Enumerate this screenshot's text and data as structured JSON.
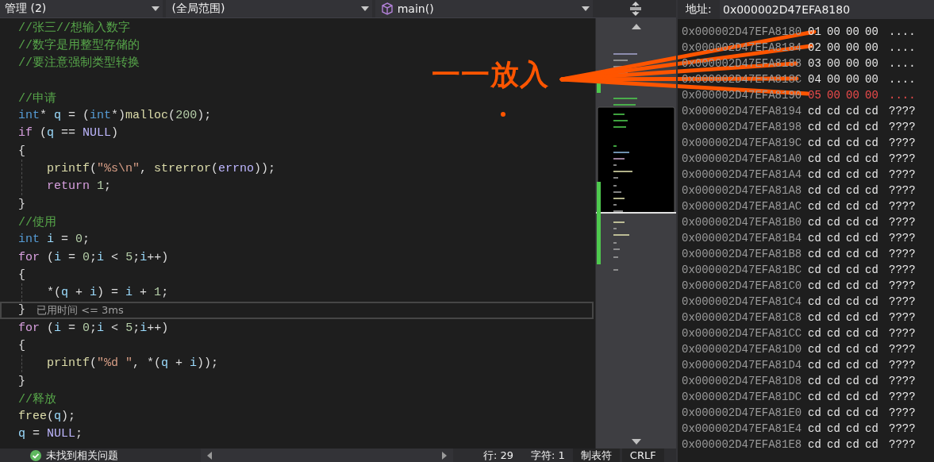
{
  "toolbar": {
    "dropdowns": [
      {
        "text": "管理 (2)",
        "kind": "plain"
      },
      {
        "text": "(全局范围)",
        "kind": "plain"
      },
      {
        "text": "main()",
        "kind": "function"
      }
    ]
  },
  "editor": {
    "lines": [
      {
        "kind": "code",
        "current": false,
        "tokens": [
          {
            "kind": "comment",
            "text": "//张三//想输入数字"
          }
        ]
      },
      {
        "kind": "code",
        "current": false,
        "tokens": [
          {
            "kind": "comment",
            "text": "//数字是用整型存储的"
          }
        ]
      },
      {
        "kind": "code",
        "current": false,
        "tokens": [
          {
            "kind": "comment",
            "text": "//要注意强制类型转换"
          }
        ]
      },
      {
        "kind": "blank",
        "current": false
      },
      {
        "kind": "code",
        "current": false,
        "tokens": [
          {
            "kind": "comment",
            "text": "//申请"
          }
        ]
      },
      {
        "kind": "code",
        "current": false,
        "tokens": [
          {
            "kind": "type",
            "text": "int"
          },
          {
            "kind": "punct",
            "text": "* "
          },
          {
            "kind": "var",
            "text": "q"
          },
          {
            "kind": "punct",
            "text": " = ("
          },
          {
            "kind": "type",
            "text": "int"
          },
          {
            "kind": "punct",
            "text": "*)"
          },
          {
            "kind": "func",
            "text": "malloc"
          },
          {
            "kind": "punct",
            "text": "("
          },
          {
            "kind": "number",
            "text": "200"
          },
          {
            "kind": "punct",
            "text": ");"
          }
        ]
      },
      {
        "kind": "code",
        "current": false,
        "tokens": [
          {
            "kind": "control",
            "text": "if"
          },
          {
            "kind": "punct",
            "text": " ("
          },
          {
            "kind": "var",
            "text": "q"
          },
          {
            "kind": "punct",
            "text": " == "
          },
          {
            "kind": "macro",
            "text": "NULL"
          },
          {
            "kind": "punct",
            "text": ")"
          }
        ]
      },
      {
        "kind": "code",
        "current": false,
        "tokens": [
          {
            "kind": "punct",
            "text": "{"
          }
        ],
        "children": [
          {
            "kind": "code",
            "current": false,
            "tokens": [
              {
                "kind": "func",
                "text": "printf"
              },
              {
                "kind": "punct",
                "text": "("
              },
              {
                "kind": "string",
                "text": "\"%s\\n\""
              },
              {
                "kind": "punct",
                "text": ", "
              },
              {
                "kind": "func",
                "text": "strerror"
              },
              {
                "kind": "punct",
                "text": "("
              },
              {
                "kind": "macro",
                "text": "errno"
              },
              {
                "kind": "punct",
                "text": "));"
              }
            ]
          },
          {
            "kind": "code",
            "current": false,
            "tokens": [
              {
                "kind": "control",
                "text": "return "
              },
              {
                "kind": "number",
                "text": "1"
              },
              {
                "kind": "punct",
                "text": ";"
              }
            ]
          }
        ]
      },
      {
        "kind": "code",
        "current": false,
        "tokens": [
          {
            "kind": "punct",
            "text": "}"
          }
        ]
      },
      {
        "kind": "code",
        "current": false,
        "tokens": [
          {
            "kind": "comment",
            "text": "//使用"
          }
        ]
      },
      {
        "kind": "code",
        "current": false,
        "tokens": [
          {
            "kind": "type",
            "text": "int "
          },
          {
            "kind": "var",
            "text": "i"
          },
          {
            "kind": "punct",
            "text": " = "
          },
          {
            "kind": "number",
            "text": "0"
          },
          {
            "kind": "punct",
            "text": ";"
          }
        ]
      },
      {
        "kind": "code",
        "current": false,
        "tokens": [
          {
            "kind": "control",
            "text": "for"
          },
          {
            "kind": "punct",
            "text": " ("
          },
          {
            "kind": "var",
            "text": "i"
          },
          {
            "kind": "punct",
            "text": " = "
          },
          {
            "kind": "number",
            "text": "0"
          },
          {
            "kind": "punct",
            "text": ";"
          },
          {
            "kind": "var",
            "text": "i"
          },
          {
            "kind": "punct",
            "text": " < "
          },
          {
            "kind": "number",
            "text": "5"
          },
          {
            "kind": "punct",
            "text": ";"
          },
          {
            "kind": "var",
            "text": "i"
          },
          {
            "kind": "punct",
            "text": "++)"
          }
        ]
      },
      {
        "kind": "code",
        "current": false,
        "tokens": [
          {
            "kind": "punct",
            "text": "{"
          }
        ],
        "children": [
          {
            "kind": "code",
            "current": false,
            "tokens": [
              {
                "kind": "punct",
                "text": "*("
              },
              {
                "kind": "var",
                "text": "q"
              },
              {
                "kind": "punct",
                "text": " + "
              },
              {
                "kind": "var",
                "text": "i"
              },
              {
                "kind": "punct",
                "text": ") = "
              },
              {
                "kind": "var",
                "text": "i"
              },
              {
                "kind": "punct",
                "text": " + "
              },
              {
                "kind": "number",
                "text": "1"
              },
              {
                "kind": "punct",
                "text": ";"
              }
            ]
          }
        ]
      },
      {
        "kind": "code",
        "current": true,
        "tokens": [
          {
            "kind": "punct",
            "text": "}"
          }
        ],
        "hint": "已用时间 <= 3ms"
      },
      {
        "kind": "code",
        "current": false,
        "tokens": [
          {
            "kind": "control",
            "text": "for"
          },
          {
            "kind": "punct",
            "text": " ("
          },
          {
            "kind": "var",
            "text": "i"
          },
          {
            "kind": "punct",
            "text": " = "
          },
          {
            "kind": "number",
            "text": "0"
          },
          {
            "kind": "punct",
            "text": ";"
          },
          {
            "kind": "var",
            "text": "i"
          },
          {
            "kind": "punct",
            "text": " < "
          },
          {
            "kind": "number",
            "text": "5"
          },
          {
            "kind": "punct",
            "text": ";"
          },
          {
            "kind": "var",
            "text": "i"
          },
          {
            "kind": "punct",
            "text": "++)"
          }
        ]
      },
      {
        "kind": "code",
        "current": false,
        "tokens": [
          {
            "kind": "punct",
            "text": "{"
          }
        ],
        "children": [
          {
            "kind": "code",
            "current": false,
            "tokens": [
              {
                "kind": "func",
                "text": "printf"
              },
              {
                "kind": "punct",
                "text": "("
              },
              {
                "kind": "string",
                "text": "\"%d \""
              },
              {
                "kind": "punct",
                "text": ", *("
              },
              {
                "kind": "var",
                "text": "q"
              },
              {
                "kind": "punct",
                "text": " + "
              },
              {
                "kind": "var",
                "text": "i"
              },
              {
                "kind": "punct",
                "text": "));"
              }
            ]
          }
        ]
      },
      {
        "kind": "code",
        "current": false,
        "tokens": [
          {
            "kind": "punct",
            "text": "}"
          }
        ]
      },
      {
        "kind": "code",
        "current": false,
        "tokens": [
          {
            "kind": "comment",
            "text": "//释放"
          }
        ]
      },
      {
        "kind": "code",
        "current": false,
        "tokens": [
          {
            "kind": "func",
            "text": "free"
          },
          {
            "kind": "punct",
            "text": "("
          },
          {
            "kind": "var",
            "text": "q"
          },
          {
            "kind": "punct",
            "text": ");"
          }
        ]
      },
      {
        "kind": "code",
        "current": false,
        "tokens": [
          {
            "kind": "var",
            "text": "q"
          },
          {
            "kind": "punct",
            "text": " = "
          },
          {
            "kind": "macro",
            "text": "NULL"
          },
          {
            "kind": "punct",
            "text": ";"
          }
        ]
      }
    ]
  },
  "status_bar": {
    "issues": "未找到相关问题",
    "line": "行: 29",
    "char": "字符: 1",
    "indent": "制表符",
    "line_ending": "CRLF"
  },
  "memory": {
    "address_label": "地址:",
    "address": "0x000002D47EFA8180",
    "rows": [
      {
        "address": "0x000002D47EFA8180",
        "bytes": [
          "01",
          "00",
          "00",
          "00"
        ],
        "ascii": "....",
        "changed": false
      },
      {
        "address": "0x000002D47EFA8184",
        "bytes": [
          "02",
          "00",
          "00",
          "00"
        ],
        "ascii": "....",
        "changed": false
      },
      {
        "address": "0x000002D47EFA8188",
        "bytes": [
          "03",
          "00",
          "00",
          "00"
        ],
        "ascii": "....",
        "changed": false
      },
      {
        "address": "0x000002D47EFA818C",
        "bytes": [
          "04",
          "00",
          "00",
          "00"
        ],
        "ascii": "....",
        "changed": false
      },
      {
        "address": "0x000002D47EFA8190",
        "bytes": [
          "05",
          "00",
          "00",
          "00"
        ],
        "ascii": "....",
        "changed": true
      },
      {
        "address": "0x000002D47EFA8194",
        "bytes": [
          "cd",
          "cd",
          "cd",
          "cd"
        ],
        "ascii": "????",
        "changed": false
      },
      {
        "address": "0x000002D47EFA8198",
        "bytes": [
          "cd",
          "cd",
          "cd",
          "cd"
        ],
        "ascii": "????",
        "changed": false
      },
      {
        "address": "0x000002D47EFA819C",
        "bytes": [
          "cd",
          "cd",
          "cd",
          "cd"
        ],
        "ascii": "????",
        "changed": false
      },
      {
        "address": "0x000002D47EFA81A0",
        "bytes": [
          "cd",
          "cd",
          "cd",
          "cd"
        ],
        "ascii": "????",
        "changed": false
      },
      {
        "address": "0x000002D47EFA81A4",
        "bytes": [
          "cd",
          "cd",
          "cd",
          "cd"
        ],
        "ascii": "????",
        "changed": false
      },
      {
        "address": "0x000002D47EFA81A8",
        "bytes": [
          "cd",
          "cd",
          "cd",
          "cd"
        ],
        "ascii": "????",
        "changed": false
      },
      {
        "address": "0x000002D47EFA81AC",
        "bytes": [
          "cd",
          "cd",
          "cd",
          "cd"
        ],
        "ascii": "????",
        "changed": false
      },
      {
        "address": "0x000002D47EFA81B0",
        "bytes": [
          "cd",
          "cd",
          "cd",
          "cd"
        ],
        "ascii": "????",
        "changed": false
      },
      {
        "address": "0x000002D47EFA81B4",
        "bytes": [
          "cd",
          "cd",
          "cd",
          "cd"
        ],
        "ascii": "????",
        "changed": false
      },
      {
        "address": "0x000002D47EFA81B8",
        "bytes": [
          "cd",
          "cd",
          "cd",
          "cd"
        ],
        "ascii": "????",
        "changed": false
      },
      {
        "address": "0x000002D47EFA81BC",
        "bytes": [
          "cd",
          "cd",
          "cd",
          "cd"
        ],
        "ascii": "????",
        "changed": false
      },
      {
        "address": "0x000002D47EFA81C0",
        "bytes": [
          "cd",
          "cd",
          "cd",
          "cd"
        ],
        "ascii": "????",
        "changed": false
      },
      {
        "address": "0x000002D47EFA81C4",
        "bytes": [
          "cd",
          "cd",
          "cd",
          "cd"
        ],
        "ascii": "????",
        "changed": false
      },
      {
        "address": "0x000002D47EFA81C8",
        "bytes": [
          "cd",
          "cd",
          "cd",
          "cd"
        ],
        "ascii": "????",
        "changed": false
      },
      {
        "address": "0x000002D47EFA81CC",
        "bytes": [
          "cd",
          "cd",
          "cd",
          "cd"
        ],
        "ascii": "????",
        "changed": false
      },
      {
        "address": "0x000002D47EFA81D0",
        "bytes": [
          "cd",
          "cd",
          "cd",
          "cd"
        ],
        "ascii": "????",
        "changed": false
      },
      {
        "address": "0x000002D47EFA81D4",
        "bytes": [
          "cd",
          "cd",
          "cd",
          "cd"
        ],
        "ascii": "????",
        "changed": false
      },
      {
        "address": "0x000002D47EFA81D8",
        "bytes": [
          "cd",
          "cd",
          "cd",
          "cd"
        ],
        "ascii": "????",
        "changed": false
      },
      {
        "address": "0x000002D47EFA81DC",
        "bytes": [
          "cd",
          "cd",
          "cd",
          "cd"
        ],
        "ascii": "????",
        "changed": false
      },
      {
        "address": "0x000002D47EFA81E0",
        "bytes": [
          "cd",
          "cd",
          "cd",
          "cd"
        ],
        "ascii": "????",
        "changed": false
      },
      {
        "address": "0x000002D47EFA81E4",
        "bytes": [
          "cd",
          "cd",
          "cd",
          "cd"
        ],
        "ascii": "????",
        "changed": false
      },
      {
        "address": "0x000002D47EFA81E8",
        "bytes": [
          "cd",
          "cd",
          "cd",
          "cd"
        ],
        "ascii": "????",
        "changed": false
      }
    ]
  },
  "annotation": {
    "text": "一一放入"
  }
}
